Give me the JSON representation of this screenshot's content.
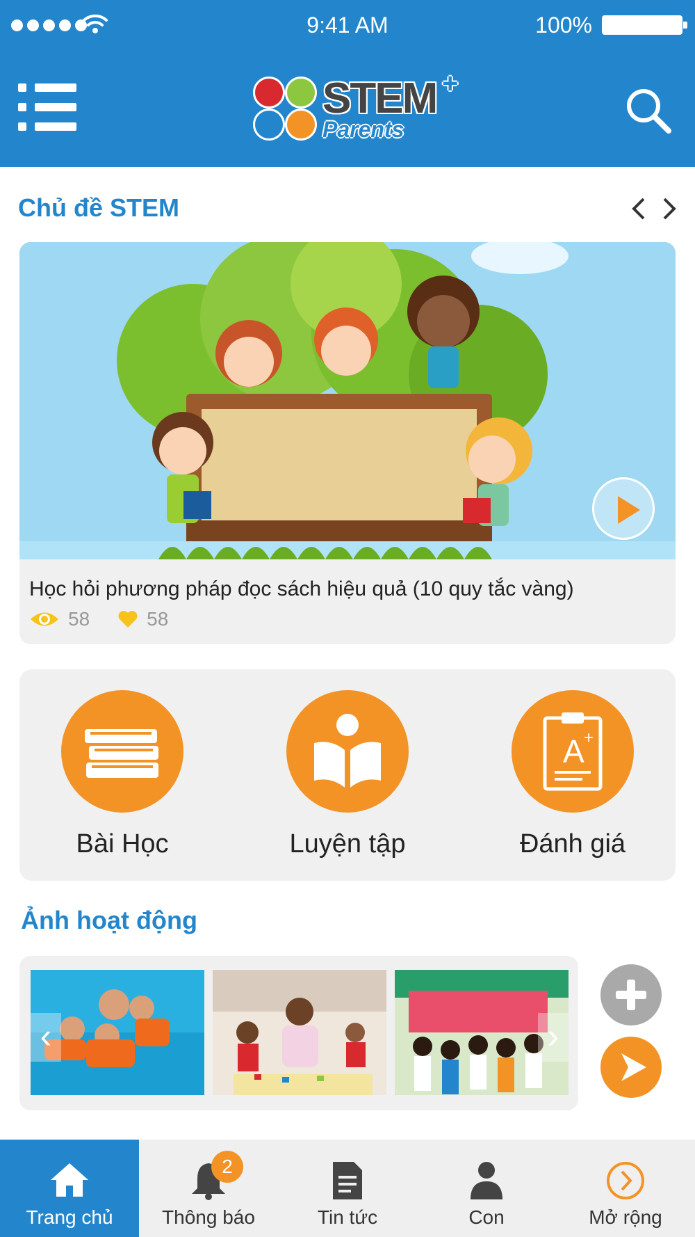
{
  "status_bar": {
    "time": "9:41 AM",
    "battery": "100%"
  },
  "header": {
    "logo_text": "STEM",
    "logo_plus": "+",
    "logo_sub": "Parents"
  },
  "stem_section": {
    "title": "Chủ đề STEM",
    "featured": {
      "caption": "Học hỏi phương pháp đọc sách hiệu quả (10 quy tắc vàng)",
      "views": "58",
      "likes": "58"
    }
  },
  "categories": [
    {
      "label": "Bài Học",
      "icon": "books-icon"
    },
    {
      "label": "Luyện tập",
      "icon": "reading-icon"
    },
    {
      "label": "Đánh giá",
      "icon": "grade-clipboard-icon"
    }
  ],
  "activity_section": {
    "title": "Ảnh hoạt động"
  },
  "tabbar": {
    "items": [
      {
        "label": "Trang chủ",
        "icon": "home-icon"
      },
      {
        "label": "Thông báo",
        "icon": "bell-icon"
      },
      {
        "label": "Tin tức",
        "icon": "news-icon"
      },
      {
        "label": "Con",
        "icon": "person-icon"
      },
      {
        "label": "Mở rộng",
        "icon": "chevron-right-circle-icon"
      }
    ],
    "notification_count": "2"
  },
  "colors": {
    "primary": "#2386cc",
    "accent": "#f39325",
    "panel": "#f0f0f0"
  }
}
